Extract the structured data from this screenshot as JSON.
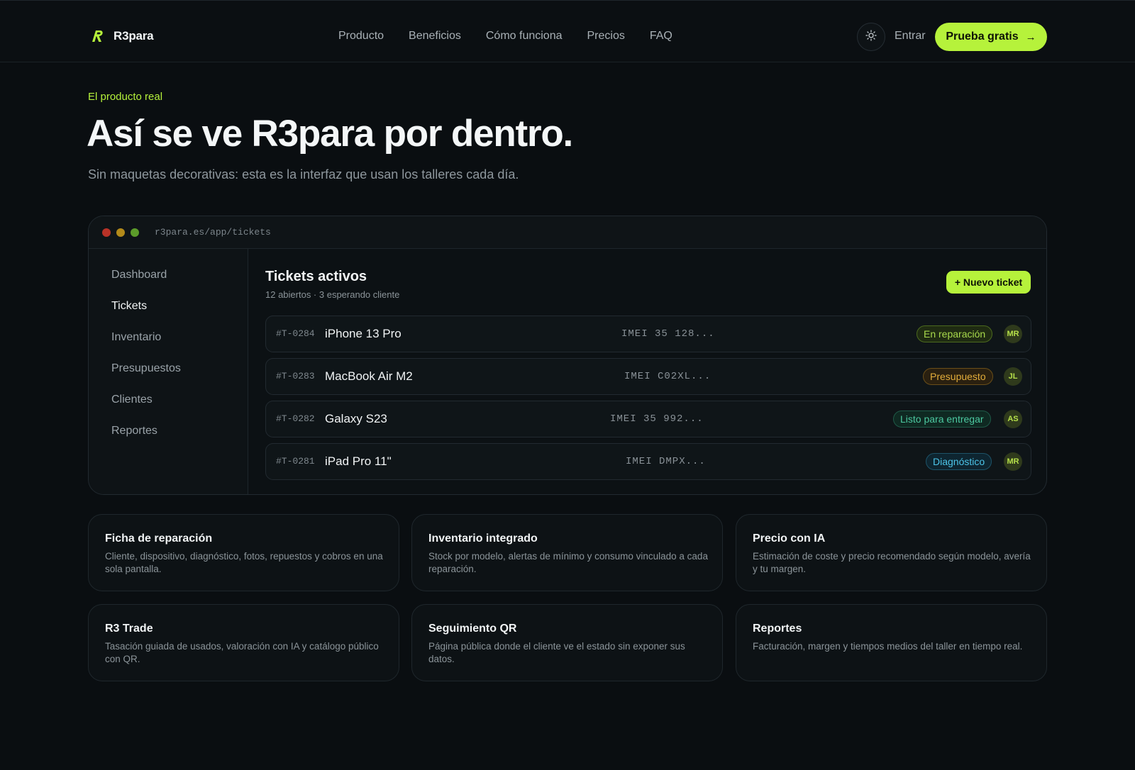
{
  "brand": {
    "name": "R3para",
    "accent": "#b6f23b"
  },
  "nav": {
    "items": [
      "Producto",
      "Beneficios",
      "Cómo funciona",
      "Precios",
      "FAQ"
    ],
    "theme_icon": "sun-icon",
    "login": "Entrar",
    "cta": "Prueba gratis",
    "cta_icon": "arrow-right-icon"
  },
  "hero": {
    "eyebrow": "El producto real",
    "title": "Así se ve R3para por dentro.",
    "subtitle": "Sin maquetas decorativas: esta es la interfaz que usan los talleres cada día."
  },
  "app": {
    "url": "r3para.es/app/tickets",
    "sidebar": [
      "Dashboard",
      "Tickets",
      "Inventario",
      "Presupuestos",
      "Clientes",
      "Reportes"
    ],
    "active_sidebar": "Tickets",
    "title": "Tickets activos",
    "subtitle": "12 abiertos · 3 esperando cliente",
    "new_ticket": "+ Nuevo ticket",
    "tickets": [
      {
        "id": "#T-0284",
        "device": "iPhone 13 Pro",
        "imei": "IMEI 35 128...",
        "status": "En reparación",
        "status_color": "#a8d94c",
        "assignee": "MR"
      },
      {
        "id": "#T-0283",
        "device": "MacBook Air M2",
        "imei": "IMEI C02XL...",
        "status": "Presupuesto",
        "status_color": "#e3ad3a",
        "assignee": "JL"
      },
      {
        "id": "#T-0282",
        "device": "Galaxy S23",
        "imei": "IMEI 35 992...",
        "status": "Listo para entregar",
        "status_color": "#4cc9a0",
        "assignee": "AS"
      },
      {
        "id": "#T-0281",
        "device": "iPad Pro 11\"",
        "imei": "IMEI DMPX...",
        "status": "Diagnóstico",
        "status_color": "#4cc4e8",
        "assignee": "MR"
      }
    ]
  },
  "features": [
    {
      "title": "Ficha de reparación",
      "desc": "Cliente, dispositivo, diagnóstico, fotos, repuestos y cobros en una sola pantalla."
    },
    {
      "title": "Inventario integrado",
      "desc": "Stock por modelo, alertas de mínimo y consumo vinculado a cada reparación."
    },
    {
      "title": "Precio con IA",
      "desc": "Estimación de coste y precio recomendado según modelo, avería y tu margen."
    },
    {
      "title": "R3 Trade",
      "desc": "Tasación guiada de usados, valoración con IA y catálogo público con QR."
    },
    {
      "title": "Seguimiento QR",
      "desc": "Página pública donde el cliente ve el estado sin exponer sus datos."
    },
    {
      "title": "Reportes",
      "desc": "Facturación, margen y tiempos medios del taller en tiempo real."
    }
  ]
}
